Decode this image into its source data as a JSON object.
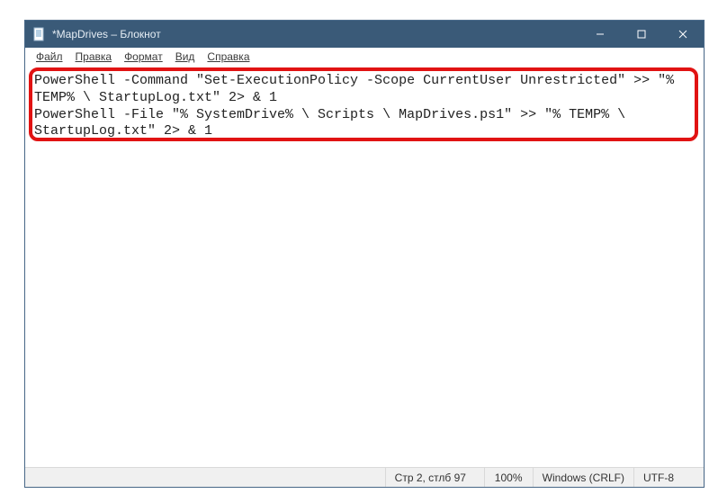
{
  "window": {
    "title": "*MapDrives – Блокнот"
  },
  "menu": {
    "file": "Файл",
    "edit": "Правка",
    "format": "Формат",
    "view": "Вид",
    "help": "Справка"
  },
  "editor": {
    "text": "PowerShell -Command \"Set-ExecutionPolicy -Scope CurrentUser Unrestricted\" >> \"% TEMP% \\ StartupLog.txt\" 2> & 1\nPowerShell -File \"% SystemDrive% \\ Scripts \\ MapDrives.ps1\" >> \"% TEMP% \\ StartupLog.txt\" 2> & 1"
  },
  "status": {
    "position": "Стр 2, стлб 97",
    "zoom": "100%",
    "eol": "Windows (CRLF)",
    "encoding": "UTF-8"
  },
  "colors": {
    "titlebar": "#3a5a78",
    "highlight": "#e11313"
  }
}
